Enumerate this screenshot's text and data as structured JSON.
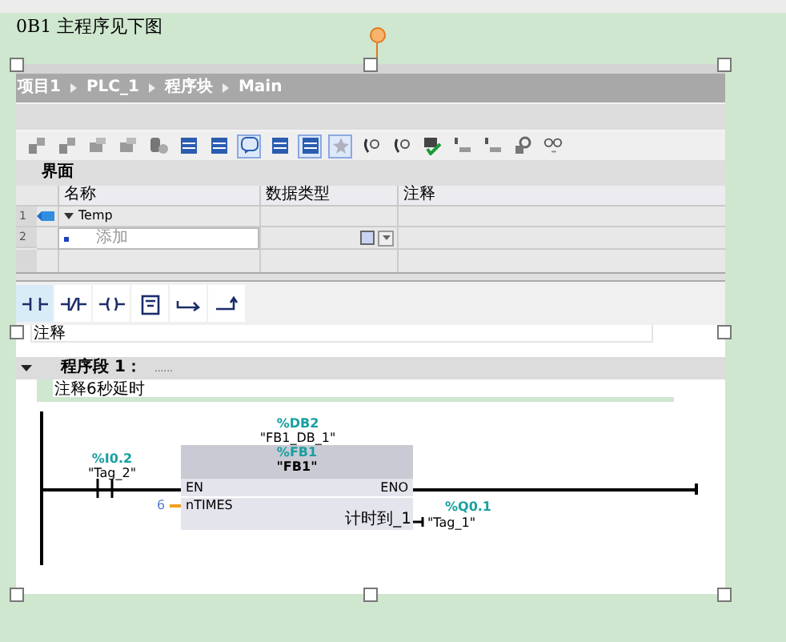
{
  "caption": "0B1 主程序见下图",
  "breadcrumb": [
    "项目1",
    "PLC_1",
    "程序块",
    "Main"
  ],
  "toolbar": [
    {
      "kind": "block",
      "selected": false
    },
    {
      "kind": "block",
      "selected": false
    },
    {
      "kind": "stack",
      "selected": false
    },
    {
      "kind": "stack",
      "selected": false
    },
    {
      "kind": "db",
      "selected": false
    },
    {
      "kind": "lines",
      "selected": false
    },
    {
      "kind": "lines",
      "selected": false
    },
    {
      "kind": "comment",
      "selected": true
    },
    {
      "kind": "lines",
      "selected": false
    },
    {
      "kind": "lines",
      "selected": true
    },
    {
      "kind": "star",
      "selected": true
    },
    {
      "kind": "jump",
      "selected": false
    },
    {
      "kind": "jump",
      "selected": false
    },
    {
      "kind": "check",
      "selected": false
    },
    {
      "kind": "tick",
      "selected": false
    },
    {
      "kind": "tick",
      "selected": false
    },
    {
      "kind": "key",
      "selected": false
    },
    {
      "kind": "glasses",
      "selected": false
    }
  ],
  "interface": {
    "title": "界面",
    "columns": [
      "名称",
      "数据类型",
      "注释"
    ],
    "rows": [
      {
        "number": "1",
        "name": "Temp",
        "expanded": true
      },
      {
        "number": "2",
        "placeholder": "添加"
      }
    ]
  },
  "palette": [
    {
      "kind": "no-contact",
      "selected": true
    },
    {
      "kind": "nc-contact",
      "selected": false
    },
    {
      "kind": "coil",
      "selected": false
    },
    {
      "kind": "box",
      "selected": false
    },
    {
      "kind": "branch-open",
      "selected": false
    },
    {
      "kind": "branch-close",
      "selected": false
    }
  ],
  "block_comment": "注释",
  "network": {
    "title": "程序段 1：",
    "dots": "......",
    "expanded": true,
    "comment": "注释6秒延时",
    "contact": {
      "address": "%I0.2",
      "tag": "\"Tag_2\""
    },
    "block": {
      "instance_address": "%DB2",
      "instance": "\"FB1_DB_1\"",
      "address": "%FB1",
      "name": "\"FB1\"",
      "en": "EN",
      "eno": "ENO",
      "input": {
        "pin": "nTIMES",
        "value": "6"
      },
      "output": {
        "pin": "计时到_1",
        "address": "%Q0.1",
        "tag": "\"Tag_1\""
      }
    }
  }
}
